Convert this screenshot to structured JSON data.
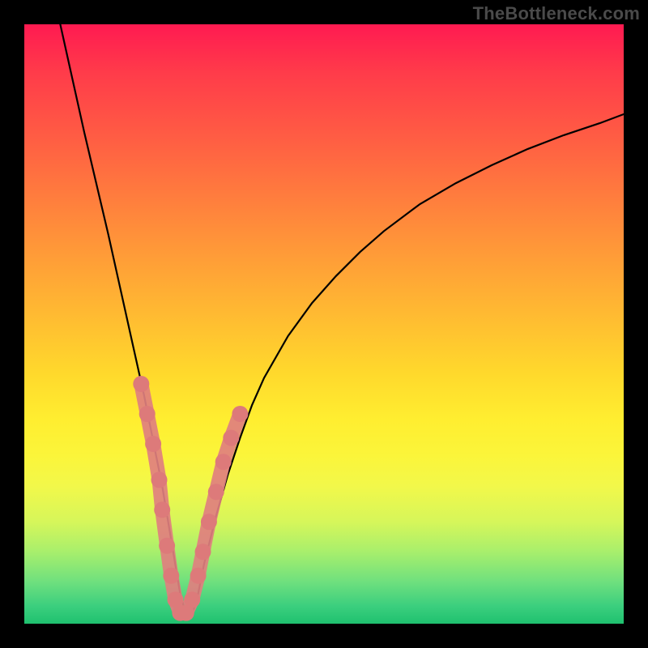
{
  "watermark": "TheBottleneck.com",
  "chart_data": {
    "type": "line",
    "title": "",
    "xlabel": "",
    "ylabel": "",
    "xlim": [
      0,
      100
    ],
    "ylim": [
      0,
      100
    ],
    "grid": false,
    "legend": false,
    "series": [
      {
        "name": "curve",
        "color": "#000000",
        "x": [
          6,
          8,
          10,
          12,
          14,
          16,
          18,
          20,
          21,
          22,
          23,
          24,
          25,
          26,
          27,
          28,
          29,
          30,
          32,
          34,
          36,
          38,
          40,
          44,
          48,
          52,
          56,
          60,
          66,
          72,
          78,
          84,
          90,
          96,
          100
        ],
        "values": [
          100,
          91,
          82,
          73.5,
          65,
          56,
          47,
          38,
          33,
          28,
          23,
          17,
          11,
          5,
          1.5,
          1.5,
          5,
          10,
          18,
          25,
          31,
          36.5,
          41,
          48,
          53.5,
          58,
          62,
          65.5,
          70,
          73.5,
          76.5,
          79.2,
          81.5,
          83.5,
          85
        ]
      },
      {
        "name": "markers",
        "color": "#e07f7f",
        "type": "scatter",
        "x": [
          19.5,
          20.5,
          21.5,
          22.5,
          23.0,
          23.8,
          24.5,
          25.2,
          26.0,
          27.0,
          28.0,
          29.0,
          29.8,
          30.8,
          32.0,
          33.2,
          34.5,
          36.0
        ],
        "values": [
          40.0,
          35.0,
          30.0,
          24.0,
          19.0,
          13.0,
          8.0,
          4.0,
          1.8,
          1.8,
          4.0,
          8.0,
          12.0,
          17.0,
          22.0,
          27.0,
          31.0,
          35.0
        ]
      }
    ],
    "notes": "Background is a continuous vertical color gradient from red (top) through orange/yellow to green (bottom); no visible axis ticks or labels; chart area is inset inside a black frame; a faint watermark 'TheBottleneck.com' sits above the top-right corner of the plot."
  }
}
